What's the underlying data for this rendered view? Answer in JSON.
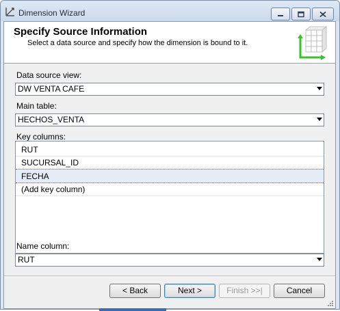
{
  "window": {
    "title": "Dimension Wizard",
    "icon": "wizard-icon",
    "controls": [
      "minimize-icon",
      "maximize-icon",
      "close-icon"
    ]
  },
  "header": {
    "title": "Specify Source Information",
    "subtitle": "Select a data source and specify how the dimension is bound to it.",
    "graphic": "dimension-cube-icon"
  },
  "data_source_view": {
    "label": "Data source view:",
    "value": "DW VENTA CAFE"
  },
  "main_table": {
    "label": "Main table:",
    "value": "HECHOS_VENTA"
  },
  "key_columns": {
    "label": "Key columns:",
    "items": [
      "RUT",
      "SUCURSAL_ID",
      "FECHA",
      "(Add key column)"
    ],
    "selected_index": 2
  },
  "name_column": {
    "label": "Name column:",
    "value": "RUT"
  },
  "buttons": {
    "back": "< Back",
    "next": "Next >",
    "finish": "Finish >>|",
    "cancel": "Cancel"
  },
  "colors": {
    "selection": "#e6ecf5",
    "title_bar": "#dbe6f3",
    "accent": "#3a6bb8"
  }
}
